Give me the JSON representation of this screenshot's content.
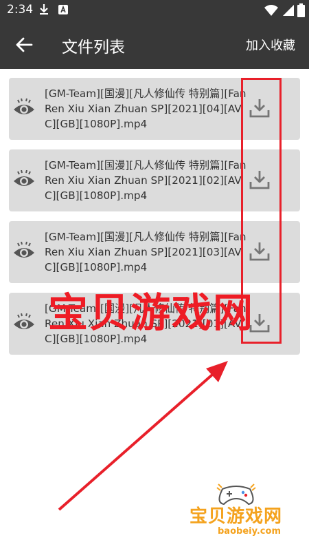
{
  "status_bar": {
    "time": "2:34"
  },
  "app_bar": {
    "title": "文件列表",
    "favorite_label": "加入收藏"
  },
  "files": [
    {
      "name": "[GM-Team][国漫][凡人修仙传 特别篇][Fan Ren Xiu Xian Zhuan SP][2021][04][AVC][GB][1080P].mp4"
    },
    {
      "name": "[GM-Team][国漫][凡人修仙传 特别篇][Fan Ren Xiu Xian Zhuan SP][2021][02][AVC][GB][1080P].mp4"
    },
    {
      "name": "[GM-Team][国漫][凡人修仙传 特别篇][Fan Ren Xiu Xian Zhuan SP][2021][03][AVC][GB][1080P].mp4"
    },
    {
      "name": "[GM-Team][国漫][凡人修仙传 特别篇][Fan Ren Xiu Xian Zhuan SP][2021][01][AVC][GB][1080P].mp4"
    }
  ],
  "watermark": {
    "text": "宝贝游戏网",
    "logo_text": "宝贝游戏网",
    "logo_url_text": "baobeiy.com"
  },
  "colors": {
    "toolbar": "#383838",
    "card": "#dcdcdc",
    "accent_red": "#e8202a",
    "logo": "#f4a21d"
  }
}
